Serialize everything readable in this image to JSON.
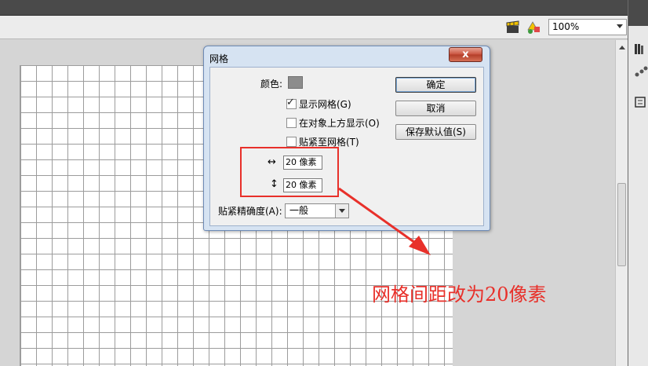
{
  "toolbar": {
    "zoom_value": "100%",
    "icons": [
      "clapperboard-icon",
      "shapes-icon"
    ]
  },
  "dialog": {
    "title": "网格",
    "close_label": "x",
    "color_label": "颜色:",
    "color_value": "#8c8c8c",
    "show_grid_label": "显示网格(G)",
    "show_grid_checked": true,
    "show_over_objects_label": "在对象上方显示(O)",
    "show_over_objects_checked": false,
    "snap_to_grid_label": "贴紧至网格(T)",
    "snap_to_grid_checked": false,
    "width_value": "20 像素",
    "height_value": "20 像素",
    "snap_accuracy_label": "贴紧精确度(A):",
    "snap_accuracy_value": "一般",
    "ok_label": "确定",
    "cancel_label": "取消",
    "save_default_label": "保存默认值(S)"
  },
  "annotation": {
    "text": "网格间距改为20像素",
    "color": "#e8302a"
  }
}
